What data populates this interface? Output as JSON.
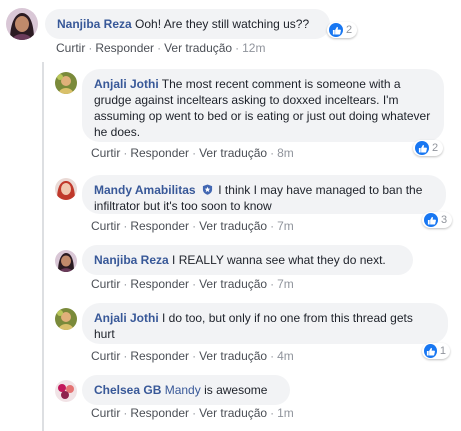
{
  "actions": {
    "reply_label": "Curtir",
    "respond_label": "Responder",
    "translate_label": "Ver tradução",
    "separator": "·"
  },
  "colors": {
    "author": "#385898",
    "bubble": "#f2f3f5",
    "like": "#1877f2",
    "meta": "#90949c"
  },
  "comments": [
    {
      "author": "Nanjiba Reza",
      "text": "Ooh! Are they still watching us??",
      "time": "12m",
      "reactions": "2",
      "avatar_icon": "avatar-icon"
    },
    {
      "author": "Anjali Jothi",
      "text": "The most recent comment is someone with a grudge against inceltears asking to doxxed inceltears. I'm assuming op went to bed or is eating or just out doing whatever he does.",
      "time": "8m",
      "reactions": "2",
      "avatar_icon": "avatar-icon"
    },
    {
      "author": "Mandy Amabilitas",
      "text": "I think I may have managed to ban the infiltrator but it's too soon to know",
      "time": "7m",
      "reactions": "3",
      "badge_icon": "admin-shield-icon",
      "avatar_icon": "avatar-icon"
    },
    {
      "author": "Nanjiba Reza",
      "text": "I REALLY wanna see what they do next.",
      "time": "7m",
      "avatar_icon": "avatar-icon"
    },
    {
      "author": "Anjali Jothi",
      "text": "I do too, but only if no one from this thread gets hurt",
      "time": "4m",
      "reactions": "1",
      "avatar_icon": "avatar-icon"
    },
    {
      "author": "Chelsea GB",
      "mention": "Mandy",
      "text": "is awesome",
      "time": "1m",
      "avatar_icon": "avatar-icon"
    }
  ]
}
